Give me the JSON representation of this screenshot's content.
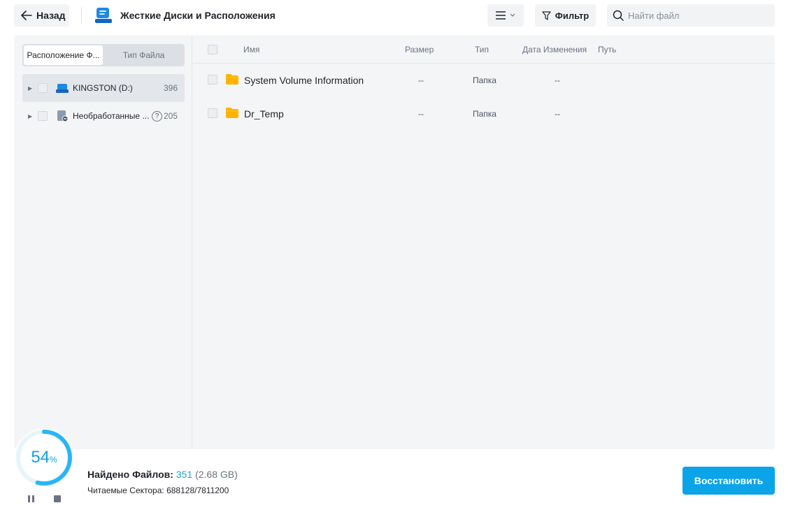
{
  "header": {
    "back_label": "Назад",
    "location_title": "Жесткие Диски и Расположения",
    "filter_label": "Фильтр",
    "search_placeholder": "Найти файл"
  },
  "sidebar": {
    "tabs": [
      {
        "label": "Расположение Ф...",
        "active": true
      },
      {
        "label": "Тип Файла",
        "active": false
      }
    ],
    "items": [
      {
        "label": "KINGSTON (D:)",
        "count": "396",
        "icon": "drive-icon",
        "selected": true
      },
      {
        "label": "Необработанные ...",
        "count": "205",
        "icon": "lost-partition-icon",
        "help": "?",
        "selected": false
      }
    ]
  },
  "table": {
    "columns": {
      "name": "Имя",
      "size": "Размер",
      "type": "Тип",
      "modified": "Дата Изменения",
      "path": "Путь"
    },
    "rows": [
      {
        "name": "System Volume Information",
        "size": "--",
        "type": "Папка",
        "modified": "--",
        "path": ""
      },
      {
        "name": "Dr_Temp",
        "size": "--",
        "type": "Папка",
        "modified": "--",
        "path": ""
      }
    ]
  },
  "footer": {
    "progress_value": "54",
    "progress_unit": "%",
    "progress_fraction": 0.54,
    "found_label": "Найдено Файлов:",
    "found_count": "351",
    "found_size": "(2.68 GB)",
    "sectors_text": "Читаемые Сектора: 688128/7811200",
    "recover_label": "Восстановить"
  },
  "colors": {
    "accent": "#0ba4e9",
    "folder": "#ffb300",
    "drive": "#1e88e5"
  }
}
